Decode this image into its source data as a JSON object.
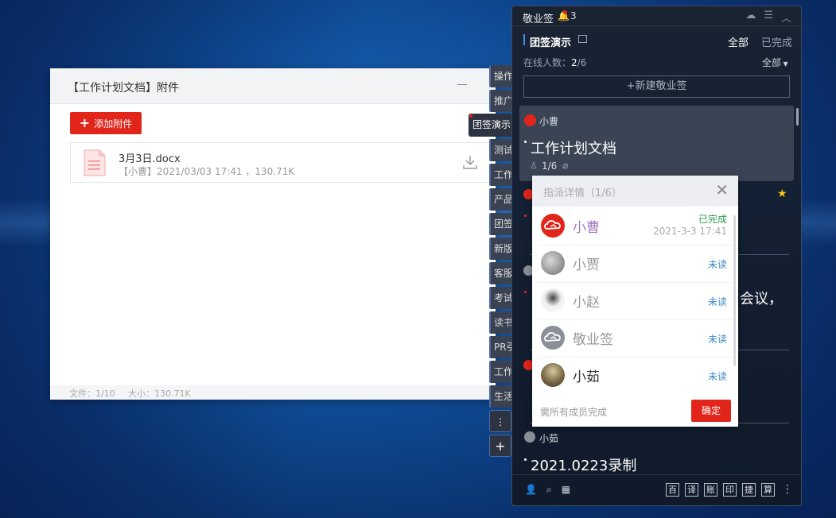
{
  "attachment_window": {
    "title": "【工作计划文档】附件",
    "add_label": "添加附件",
    "file": {
      "name": "3月3日.docx",
      "meta": "【小曹】2021/03/03 17:41 ，130.71K"
    },
    "footer_count": "文件：1/10",
    "footer_size": "大小：130.71K"
  },
  "side_tabs": {
    "items": [
      "操作",
      "推广",
      "团签演示",
      "测试",
      "工作",
      "产品",
      "团签",
      "新版",
      "客服",
      "考试",
      "读书",
      "PR引",
      "工作",
      "生活"
    ],
    "active": "团签演示",
    "more": "⋮",
    "add": "+"
  },
  "panel": {
    "app_name": "敬业签",
    "notif_count": "3",
    "group_name": "团签演示",
    "filter_all": "全部",
    "filter_done": "已完成",
    "online_label": "在线人数：",
    "online_value": "2",
    "online_total": "/6",
    "member_filter": "全部",
    "new_note": "+新建敬业签",
    "card": {
      "user": "小曹",
      "title": "工作计划文档",
      "progress": "1/6"
    },
    "fragment": "会议，",
    "card2": {
      "user": "小茹",
      "title": "2021.0223录制"
    },
    "footer_tools": [
      "百",
      "译",
      "账",
      "印",
      "捷",
      "算"
    ]
  },
  "popup": {
    "title": "指派详情（1/6）",
    "members": [
      {
        "name": "小曹",
        "status": "已完成",
        "time": "2021-3-3 17:41"
      },
      {
        "name": "小贾",
        "status": "未读",
        "time": ""
      },
      {
        "name": "小赵",
        "status": "未读",
        "time": ""
      },
      {
        "name": "敬业签",
        "status": "未读",
        "time": ""
      },
      {
        "name": "小茹",
        "status": "未读",
        "time": ""
      }
    ],
    "hint": "需所有成员完成",
    "ok": "确定"
  },
  "colors": {
    "accent_red": "#e1251b",
    "panel_bg": "#141c29",
    "done_green": "#2e9a4e",
    "unread_blue": "#3d88c8"
  }
}
